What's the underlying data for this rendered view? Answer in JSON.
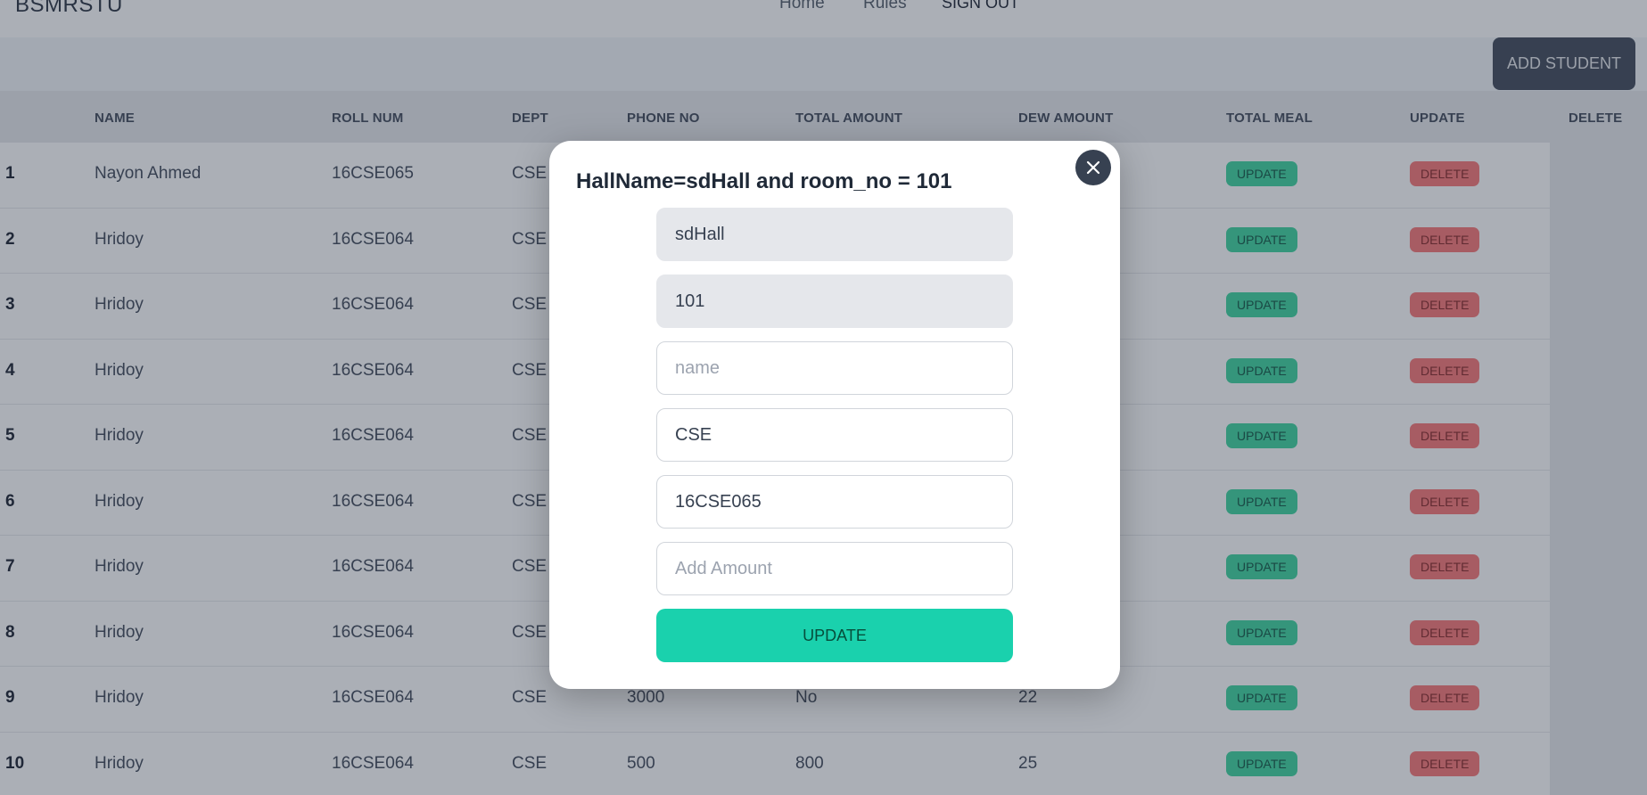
{
  "navbar": {
    "brand": "BSMRSTU",
    "links": [
      "Home",
      "Rules",
      "SIGN OUT"
    ]
  },
  "toolbar": {
    "add_student_label": "ADD STUDENT"
  },
  "table": {
    "headers": [
      "NAME",
      "ROLL NUM",
      "DEPT",
      "PHONE NO",
      "TOTAL AMOUNT",
      "DEW AMOUNT",
      "TOTAL MEAL",
      "UPDATE",
      "DELETE"
    ],
    "rows": [
      {
        "index": "1",
        "name": "Nayon Ahmed",
        "roll": "16CSE065",
        "dept": "CSE",
        "phone": "",
        "total_amount": "",
        "dew_amount": ""
      },
      {
        "index": "2",
        "name": "Hridoy",
        "roll": "16CSE064",
        "dept": "CSE",
        "phone": "",
        "total_amount": "",
        "dew_amount": ""
      },
      {
        "index": "3",
        "name": "Hridoy",
        "roll": "16CSE064",
        "dept": "CSE",
        "phone": "",
        "total_amount": "",
        "dew_amount": ""
      },
      {
        "index": "4",
        "name": "Hridoy",
        "roll": "16CSE064",
        "dept": "CSE",
        "phone": "",
        "total_amount": "",
        "dew_amount": ""
      },
      {
        "index": "5",
        "name": "Hridoy",
        "roll": "16CSE064",
        "dept": "CSE",
        "phone": "",
        "total_amount": "",
        "dew_amount": ""
      },
      {
        "index": "6",
        "name": "Hridoy",
        "roll": "16CSE064",
        "dept": "CSE",
        "phone": "",
        "total_amount": "",
        "dew_amount": ""
      },
      {
        "index": "7",
        "name": "Hridoy",
        "roll": "16CSE064",
        "dept": "CSE",
        "phone": "",
        "total_amount": "",
        "dew_amount": ""
      },
      {
        "index": "8",
        "name": "Hridoy",
        "roll": "16CSE064",
        "dept": "CSE",
        "phone": "",
        "total_amount": "",
        "dew_amount": ""
      },
      {
        "index": "9",
        "name": "Hridoy",
        "roll": "16CSE064",
        "dept": "CSE",
        "phone": "3000",
        "total_amount": "No",
        "dew_amount": "22"
      },
      {
        "index": "10",
        "name": "Hridoy",
        "roll": "16CSE064",
        "dept": "CSE",
        "phone": "500",
        "total_amount": "800",
        "dew_amount": "25"
      }
    ],
    "update_label": "UPDATE",
    "delete_label": "DELETE"
  },
  "modal": {
    "title": "HallName=sdHall and room_no = 101",
    "close_icon": "close-icon",
    "fields": {
      "hall_name": {
        "value": "sdHall",
        "placeholder": ""
      },
      "room_no": {
        "value": "101",
        "placeholder": ""
      },
      "name": {
        "value": "",
        "placeholder": "name"
      },
      "dept": {
        "value": "CSE",
        "placeholder": ""
      },
      "roll": {
        "value": "16CSE065",
        "placeholder": ""
      },
      "amount": {
        "value": "",
        "placeholder": "Add Amount"
      }
    },
    "update_label": "UPDATE"
  },
  "colors": {
    "primary_dark": "#374151",
    "accent_teal": "#1ad1ad",
    "update_badge": "#34d399",
    "delete_badge": "#f87171"
  }
}
